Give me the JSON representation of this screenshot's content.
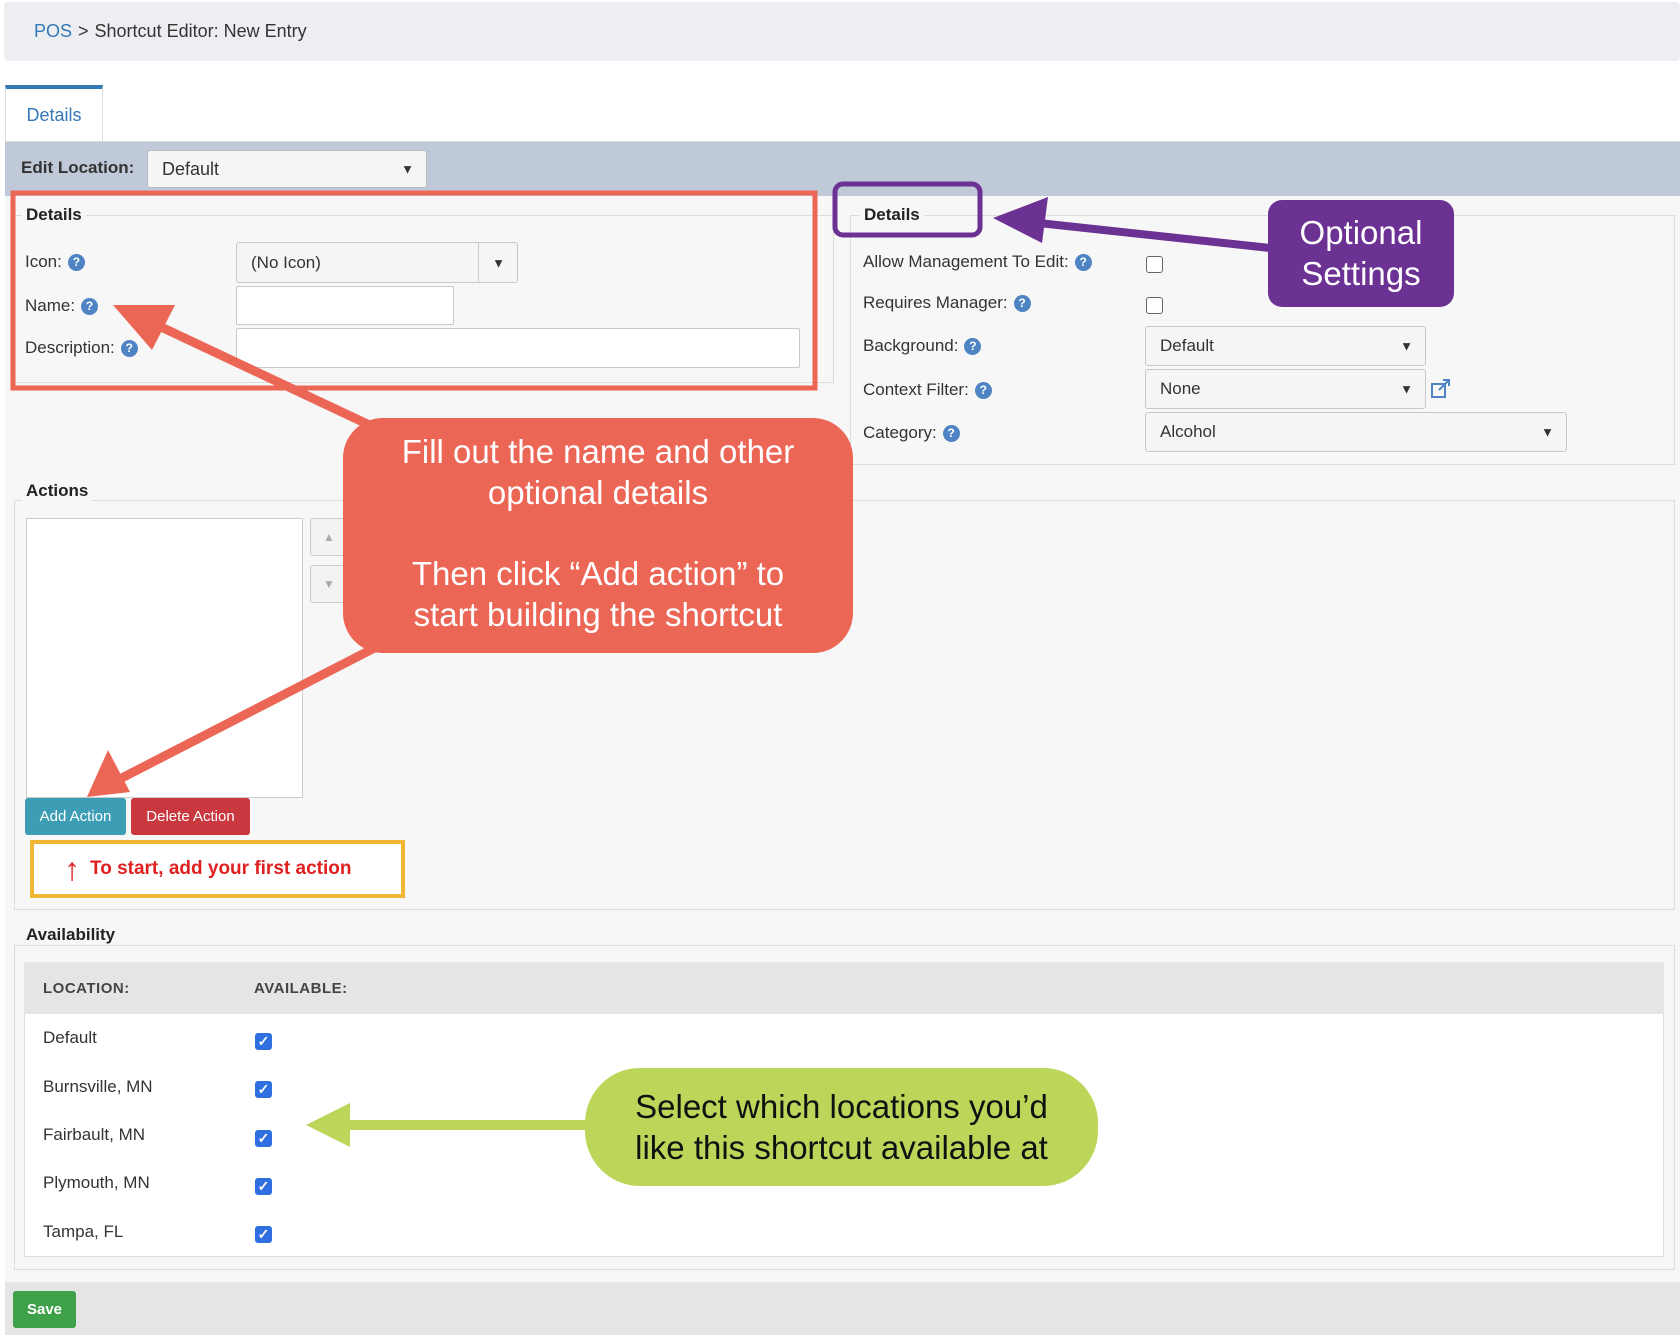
{
  "breadcrumb": {
    "root": "POS",
    "separator": ">",
    "current": "Shortcut Editor: New Entry"
  },
  "tabs": [
    {
      "label": "Details"
    }
  ],
  "edit_location": {
    "label": "Edit Location:",
    "value": "Default"
  },
  "details_left": {
    "legend": "Details",
    "icon_label": "Icon:",
    "icon_value": "(No Icon)",
    "name_label": "Name:",
    "description_label": "Description:"
  },
  "details_right": {
    "legend": "Details",
    "allow_mgmt_label": "Allow Management To Edit:",
    "requires_manager_label": "Requires Manager:",
    "background_label": "Background:",
    "background_value": "Default",
    "context_filter_label": "Context Filter:",
    "context_filter_value": "None",
    "category_label": "Category:",
    "category_value": "Alcohol"
  },
  "actions": {
    "legend": "Actions",
    "add_label": "Add Action",
    "delete_label": "Delete Action",
    "hint": "To start, add your first action"
  },
  "availability": {
    "legend": "Availability",
    "col_location": "LOCATION:",
    "col_available": "AVAILABLE:",
    "rows": [
      {
        "location": "Default",
        "available": true
      },
      {
        "location": "Burnsville, MN",
        "available": true
      },
      {
        "location": "Fairbault, MN",
        "available": true
      },
      {
        "location": "Plymouth, MN",
        "available": true
      },
      {
        "location": "Tampa, FL",
        "available": true
      }
    ]
  },
  "footer": {
    "save_label": "Save"
  },
  "annotations": {
    "optional": {
      "line1": "Optional",
      "line2": "Settings"
    },
    "fill": {
      "line1": "Fill out the name and other",
      "line2": "optional details",
      "line3": "Then click “Add action” to",
      "line4": "start building the shortcut"
    },
    "locations": {
      "line1": "Select which locations you’d",
      "line2": "like this shortcut available at"
    }
  },
  "colors": {
    "accent": "#337ab7",
    "add_button": "#3d9db5",
    "delete_button": "#c9373f",
    "save_button": "#3fa14a",
    "callout_red": "#ec6656",
    "callout_purple": "#6b3193",
    "callout_green": "#bcd65a",
    "hint_border": "#f1b633",
    "hint_text": "#e02020"
  },
  "icons": [
    "help-icon",
    "caret-down-icon",
    "external-link-icon",
    "checkbox-icon",
    "arrow-up-icon"
  ]
}
